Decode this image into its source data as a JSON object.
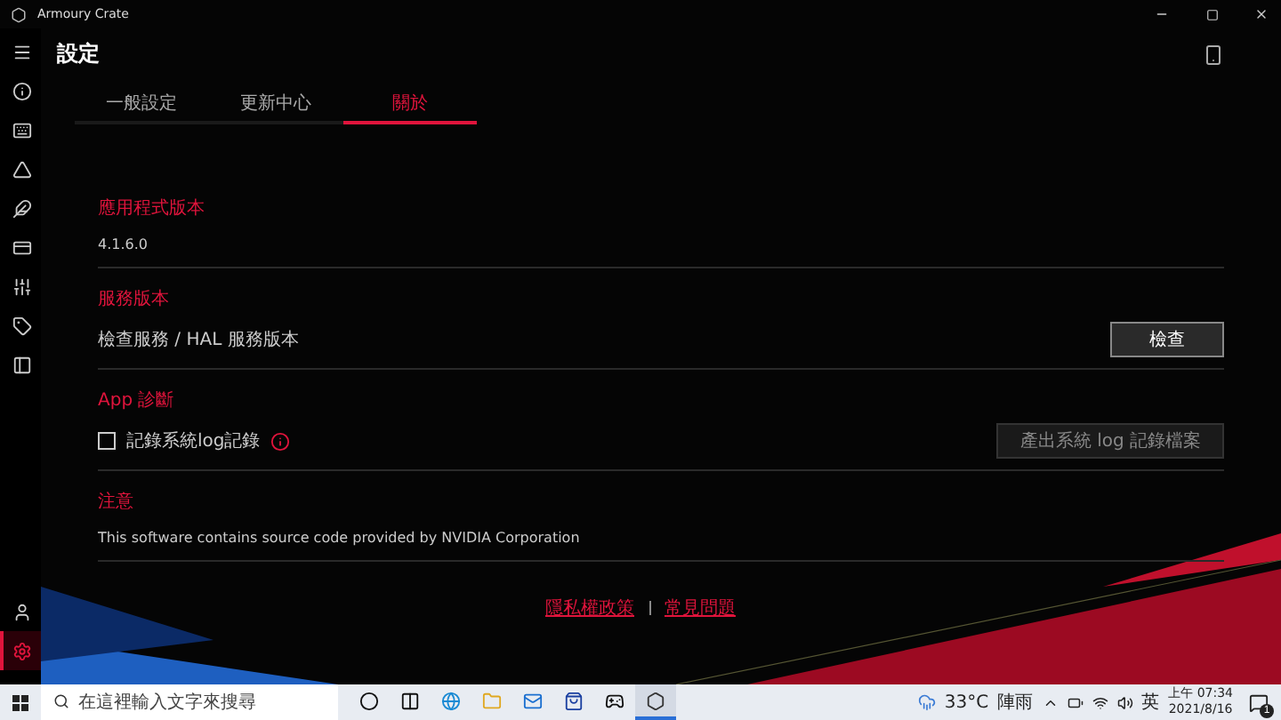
{
  "window": {
    "title": "Armoury Crate"
  },
  "sidebar": {
    "items": [
      {
        "kind": "info",
        "selected": false
      },
      {
        "kind": "keyboard",
        "selected": false
      },
      {
        "kind": "triangle",
        "selected": false
      },
      {
        "kind": "feather",
        "selected": false
      },
      {
        "kind": "card",
        "selected": false
      },
      {
        "kind": "sliders",
        "selected": false
      },
      {
        "kind": "tag",
        "selected": false
      },
      {
        "kind": "panel",
        "selected": false
      }
    ],
    "bottom_items": [
      {
        "kind": "user",
        "selected": false
      },
      {
        "kind": "settings",
        "selected": true
      }
    ]
  },
  "page": {
    "title": "設定"
  },
  "tabs": [
    {
      "label": "一般設定",
      "selected": false
    },
    {
      "label": "更新中心",
      "selected": false
    },
    {
      "label": "關於",
      "selected": true
    }
  ],
  "sections": [
    {
      "kind": "text",
      "heading": "應用程式版本",
      "value": "4.1.6.0"
    },
    {
      "kind": "button",
      "heading": "服務版本",
      "value": "檢查服務 / HAL 服務版本",
      "button": {
        "label": "檢查",
        "disabled": false
      }
    },
    {
      "kind": "checkbox",
      "heading": "App 診斷",
      "label": "記錄系統log記錄",
      "checked": false,
      "button": {
        "label": "產出系統 log 記錄檔案",
        "disabled": true
      }
    },
    {
      "kind": "text",
      "heading": "注意",
      "value": "This software contains source code provided by NVIDIA Corporation"
    }
  ],
  "footer_links": [
    "隱私權政策",
    "常見問題"
  ],
  "taskbar": {
    "search_placeholder": "在這裡輸入文字來搜尋",
    "apps": [
      {
        "kind": "cortana",
        "selected": false
      },
      {
        "kind": "taskview",
        "selected": false
      },
      {
        "kind": "browser",
        "selected": false
      },
      {
        "kind": "folder",
        "selected": false
      },
      {
        "kind": "mail",
        "selected": false
      },
      {
        "kind": "store",
        "selected": false
      },
      {
        "kind": "xbox",
        "selected": false
      },
      {
        "kind": "crate",
        "selected": true
      }
    ],
    "weather": "33°C",
    "weather_text": "陣雨",
    "ime": "英",
    "time": "上午 07:34",
    "date": "2021/8/16",
    "notifications": "1"
  }
}
